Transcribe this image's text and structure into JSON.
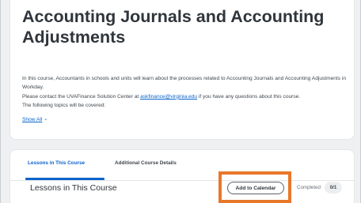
{
  "course": {
    "title": "Accounting Journals and Accounting Adjustments",
    "description_line1": "In this course, Accountants in schools and units will learn about the processes related to Accounting Journals and Accounting Adjustments in Workday.",
    "description_line2_pre": "Please contact the UVAFinance Solution Center at ",
    "email_link": "askfinance@virginia.edu",
    "description_line2_post": " if you have any questions about this course.",
    "description_line3": "The following topics will be covered:",
    "show_all_label": "Show All"
  },
  "tabs": [
    {
      "label": "Lessons in This Course",
      "active": true
    },
    {
      "label": "Additional Course Details",
      "active": false
    }
  ],
  "lessons": {
    "section_title": "Lessons in This Course",
    "add_to_calendar_label": "Add to Calendar",
    "completed_label": "Completed",
    "completed_count": "0/1"
  },
  "colors": {
    "accent": "#0b63c9",
    "highlight": "#e8782a",
    "background": "#eef0f2"
  },
  "icons": {
    "show_all": "chevron-down-icon"
  }
}
